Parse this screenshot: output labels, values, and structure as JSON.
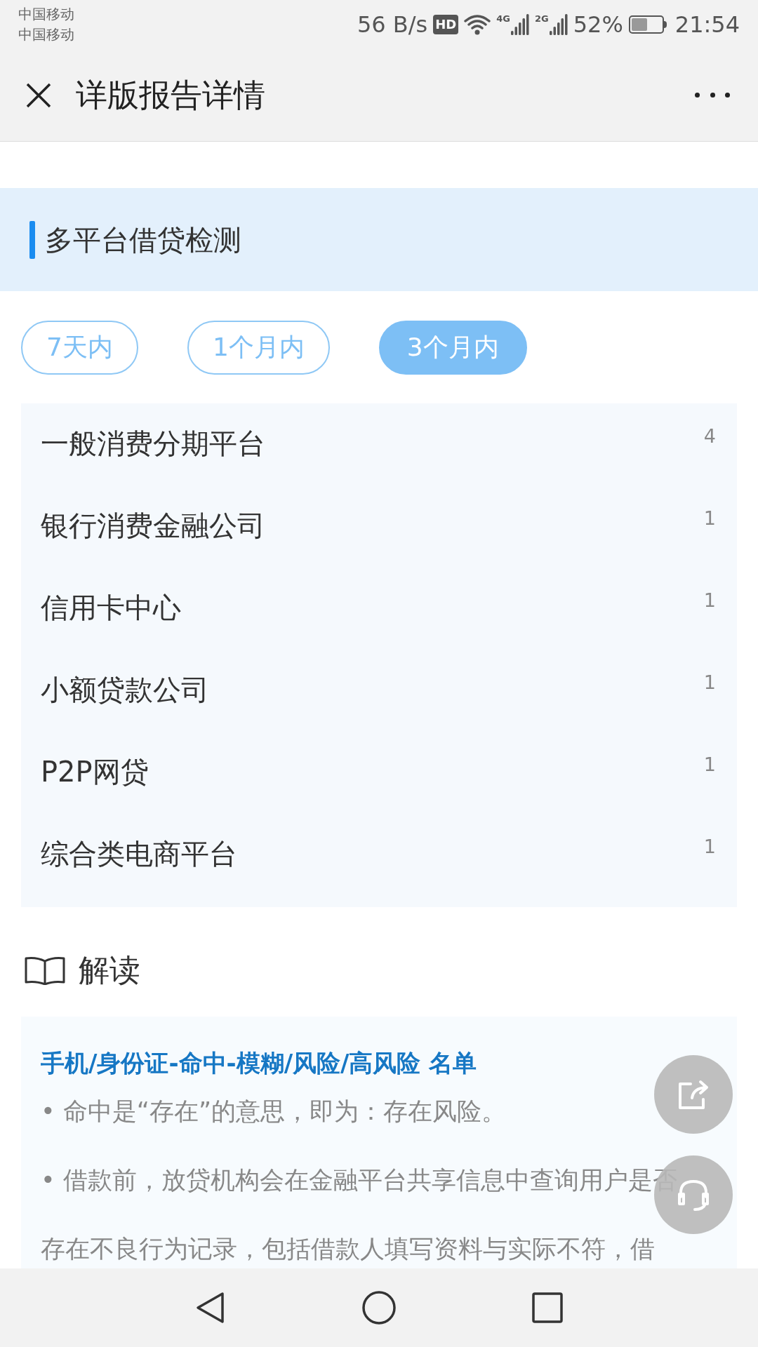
{
  "status_bar": {
    "carriers": [
      "中国移动",
      "中国移动"
    ],
    "speed": "56 B/s",
    "hd": "HD",
    "sims": [
      {
        "network": "4G"
      },
      {
        "network": "2G"
      }
    ],
    "battery": "52%",
    "level": 0.52,
    "time": "21:54"
  },
  "header": {
    "title": "详版报告详情"
  },
  "section": {
    "title": "多平台借贷检测"
  },
  "tabs": [
    {
      "label": "7天内",
      "selected": false
    },
    {
      "label": "1个月内",
      "selected": false
    },
    {
      "label": "3个月内",
      "selected": true
    }
  ],
  "rows": [
    {
      "label": "一般消费分期平台",
      "count": "4"
    },
    {
      "label": "银行消费金融公司",
      "count": "1"
    },
    {
      "label": "信用卡中心",
      "count": "1"
    },
    {
      "label": "小额贷款公司",
      "count": "1"
    },
    {
      "label": "P2P网贷",
      "count": "1"
    },
    {
      "label": "综合类电商平台",
      "count": "1"
    }
  ],
  "interpretation": {
    "heading": "解读",
    "title": "手机/身份证-命中-模糊/风险/高风险 名单",
    "bullets": [
      "• 命中是“存在”的意思，即为：存在风险。",
      "• 借款前，放贷机构会在金融平台共享信息中查询用户是否存在不良行为记录，包括借款人填写资料与实际不符，借"
    ]
  }
}
